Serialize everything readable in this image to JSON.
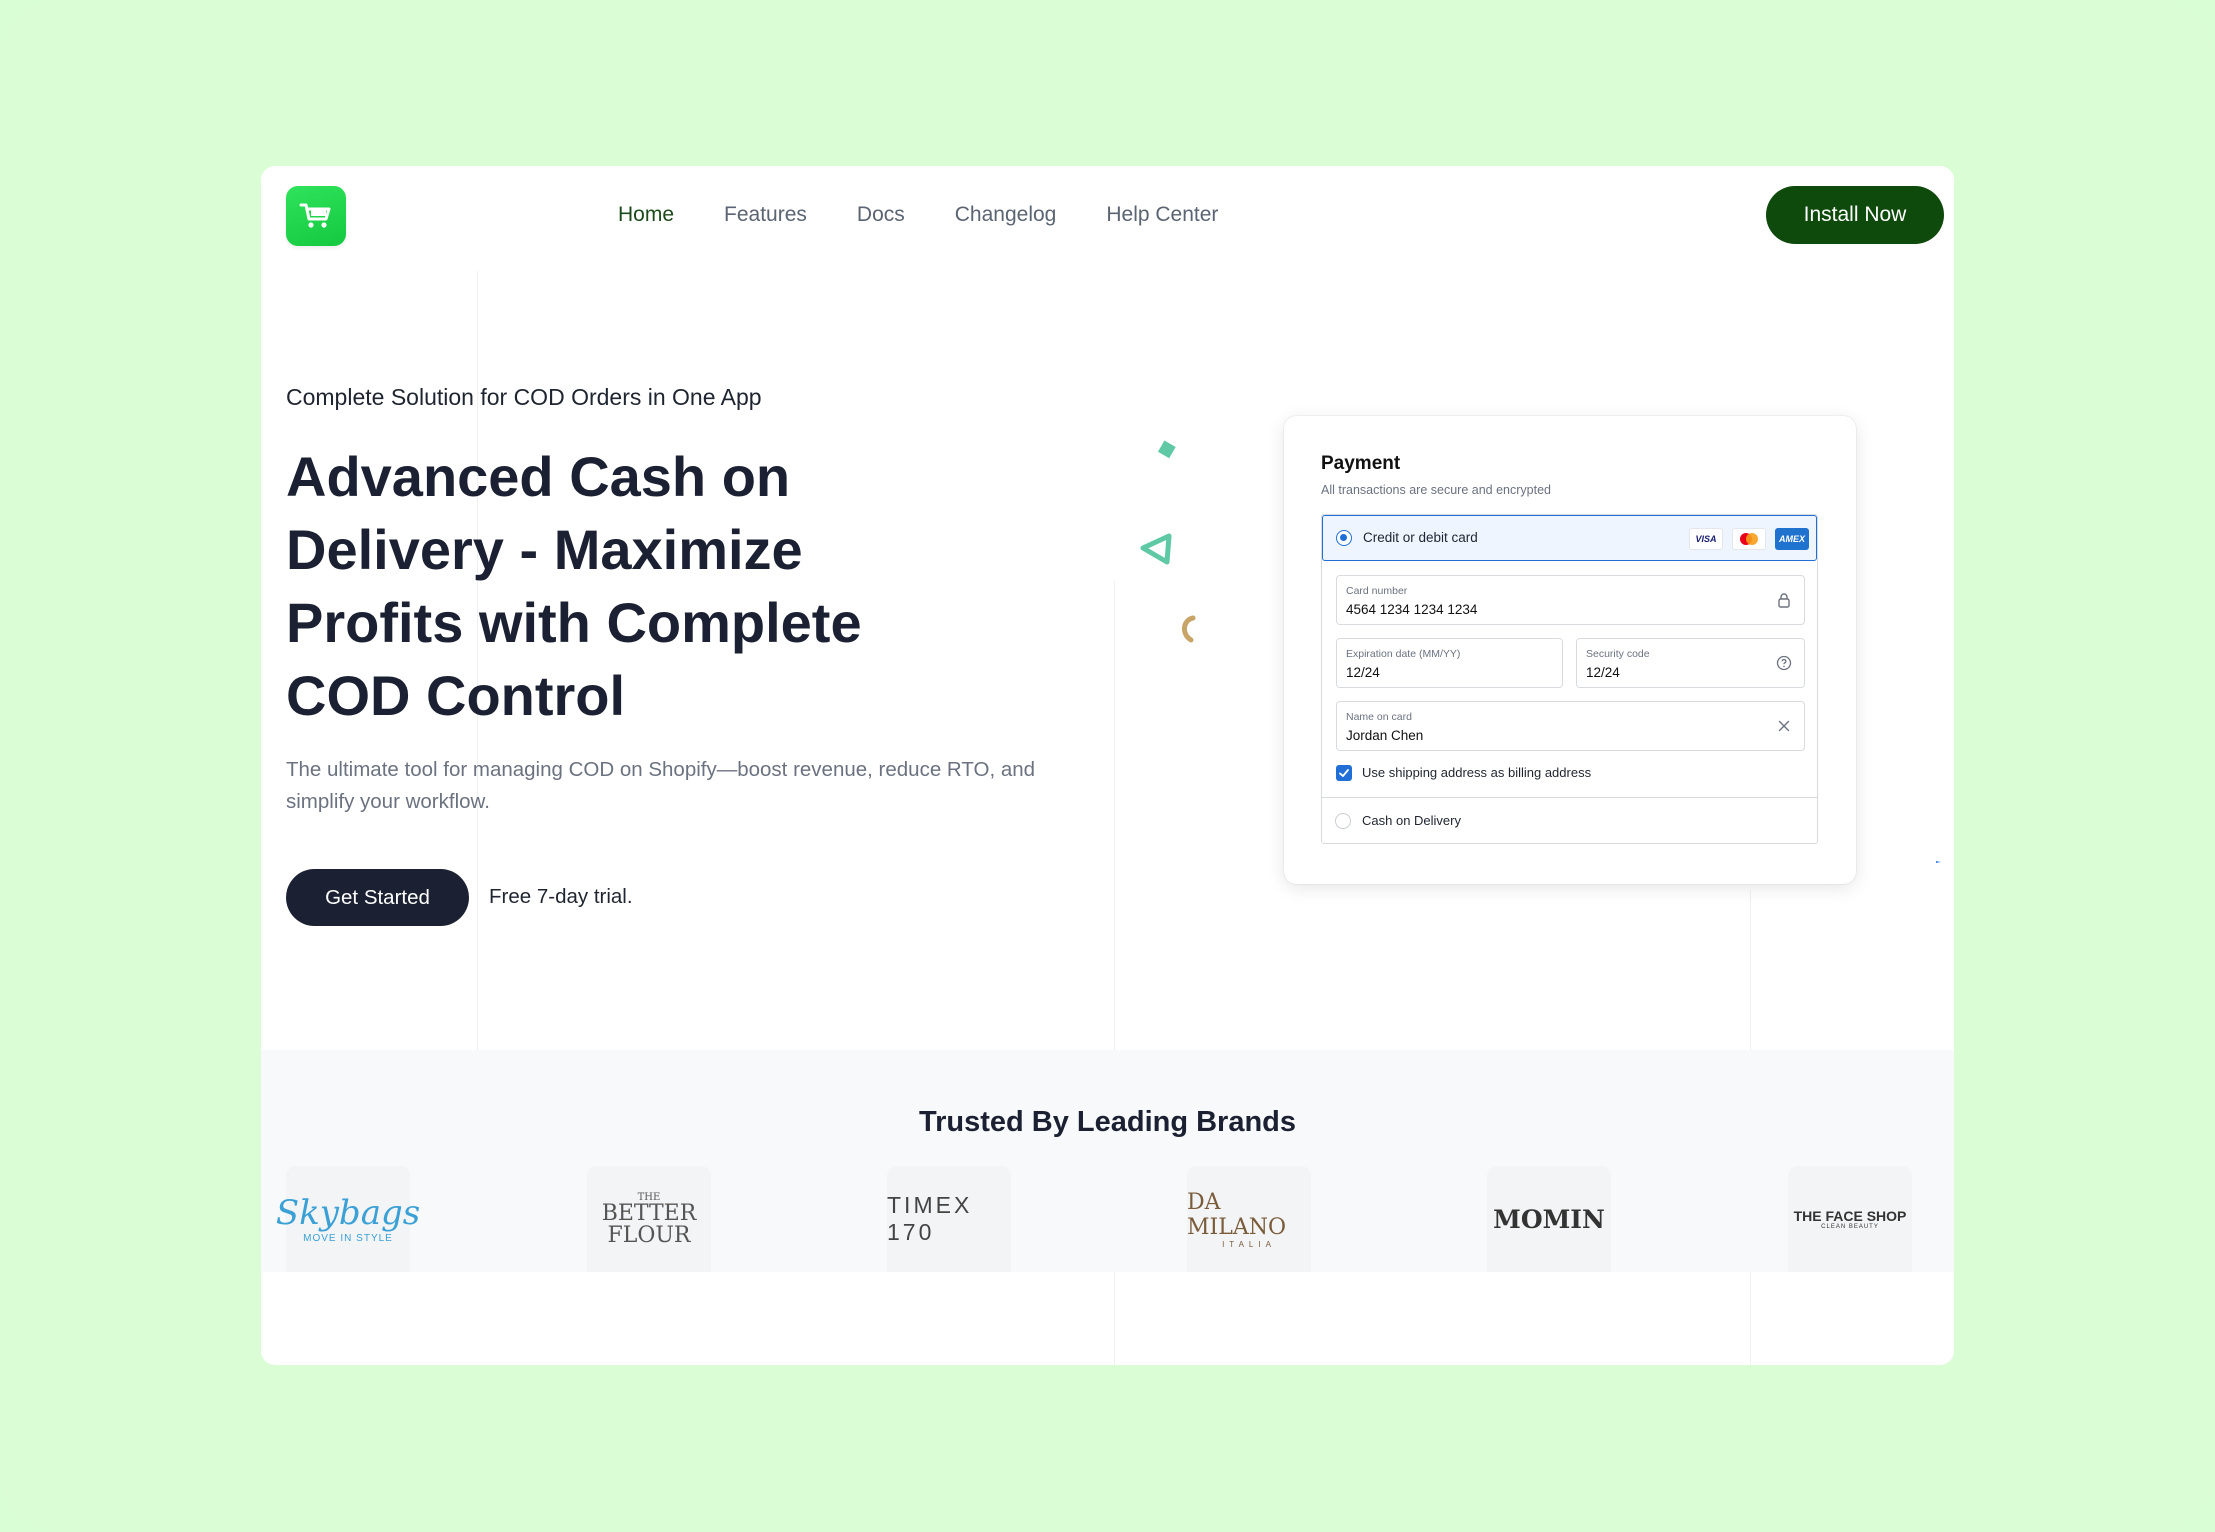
{
  "nav": {
    "links": [
      {
        "label": "Home",
        "active": true
      },
      {
        "label": "Features",
        "active": false
      },
      {
        "label": "Docs",
        "active": false
      },
      {
        "label": "Changelog",
        "active": false
      },
      {
        "label": "Help Center",
        "active": false
      }
    ],
    "cta": "Install Now",
    "logo_icon": "cart-icon"
  },
  "hero": {
    "eyebrow": "Complete Solution for COD Orders in One App",
    "title": "Advanced Cash on Delivery - Maximize Profits with Complete COD Control",
    "subtitle": "The ultimate tool for managing COD on Shopify—boost revenue, reduce RTO, and simplify your workflow.",
    "cta": "Get Started",
    "trial": "Free 7-day trial."
  },
  "payment": {
    "title": "Payment",
    "subtitle": "All transactions are secure and encrypted",
    "method_card": "Credit or debit card",
    "card_brands": [
      "VISA",
      "mastercard",
      "AMEX"
    ],
    "card_number_label": "Card number",
    "card_number": "4564 1234 1234 1234",
    "expiry_label": "Expiration date (MM/YY)",
    "expiry": "12/24",
    "security_label": "Security code",
    "security": "12/24",
    "name_label": "Name on card",
    "name": "Jordan Chen",
    "billing_checkbox": "Use shipping address as billing address",
    "method_cod": "Cash on Delivery"
  },
  "brands": {
    "title": "Trusted By Leading Brands",
    "logos": [
      {
        "name": "Skybags",
        "tagline": "MOVE IN STYLE"
      },
      {
        "name": "BETTER FLOUR",
        "tagline": "THE"
      },
      {
        "name": "TIMEX 170",
        "tagline": ""
      },
      {
        "name": "DA MILANO",
        "tagline": "ITALIA"
      },
      {
        "name": "MOMIN",
        "tagline": ""
      },
      {
        "name": "THE FACE SHOP",
        "tagline": "CLEAN BEAUTY"
      }
    ]
  },
  "colors": {
    "page_bg": "#d9fdd5",
    "install_btn": "#0f4a0d",
    "primary_dark": "#1b2132",
    "payment_accent": "#1f6fd6",
    "logo_green": "#22d24a"
  }
}
